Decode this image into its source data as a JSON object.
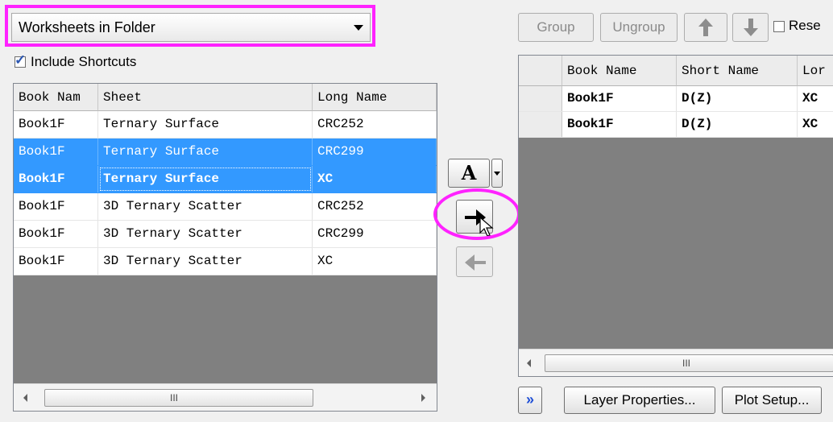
{
  "source_select": {
    "value": "Worksheets in Folder"
  },
  "include_shortcuts": {
    "label": "Include Shortcuts",
    "checked": true
  },
  "left_table": {
    "columns": [
      "Book Nam",
      "Sheet",
      "Long Name"
    ],
    "rows": [
      {
        "book": "Book1F",
        "sheet": "Ternary Surface",
        "long": "CRC252",
        "selected": false,
        "bold": false
      },
      {
        "book": "Book1F",
        "sheet": "Ternary Surface",
        "long": "CRC299",
        "selected": true,
        "bold": false
      },
      {
        "book": "Book1F",
        "sheet": "Ternary Surface",
        "long": "XC",
        "selected": true,
        "bold": true
      },
      {
        "book": "Book1F",
        "sheet": "3D Ternary Scatter",
        "long": "CRC252",
        "selected": false,
        "bold": false
      },
      {
        "book": "Book1F",
        "sheet": "3D Ternary Scatter",
        "long": "CRC299",
        "selected": false,
        "bold": false
      },
      {
        "book": "Book1F",
        "sheet": "3D Ternary Scatter",
        "long": "XC",
        "selected": false,
        "bold": false
      }
    ]
  },
  "middle": {
    "a_label": "A",
    "add_icon": "arrow-right-icon",
    "remove_icon": "arrow-left-icon"
  },
  "toolbar": {
    "group_label": "Group",
    "ungroup_label": "Ungroup",
    "up_icon": "arrow-up-icon",
    "down_icon": "arrow-down-icon",
    "reset_label": "Rese"
  },
  "right_table": {
    "columns": [
      "Book Name",
      "Short Name",
      "Lor"
    ],
    "rows": [
      {
        "book": "Book1F",
        "short": "D(Z)",
        "long": "XC"
      },
      {
        "book": "Book1F",
        "short": "D(Z)",
        "long": "XC"
      }
    ]
  },
  "scroll_grip": "III",
  "bottom": {
    "expand_label": "»",
    "layer_properties_label": "Layer Properties...",
    "plot_setup_label": "Plot Setup..."
  },
  "colors": {
    "selection": "#3399ff",
    "highlight": "#ff22ff",
    "grid_empty": "#808080"
  }
}
